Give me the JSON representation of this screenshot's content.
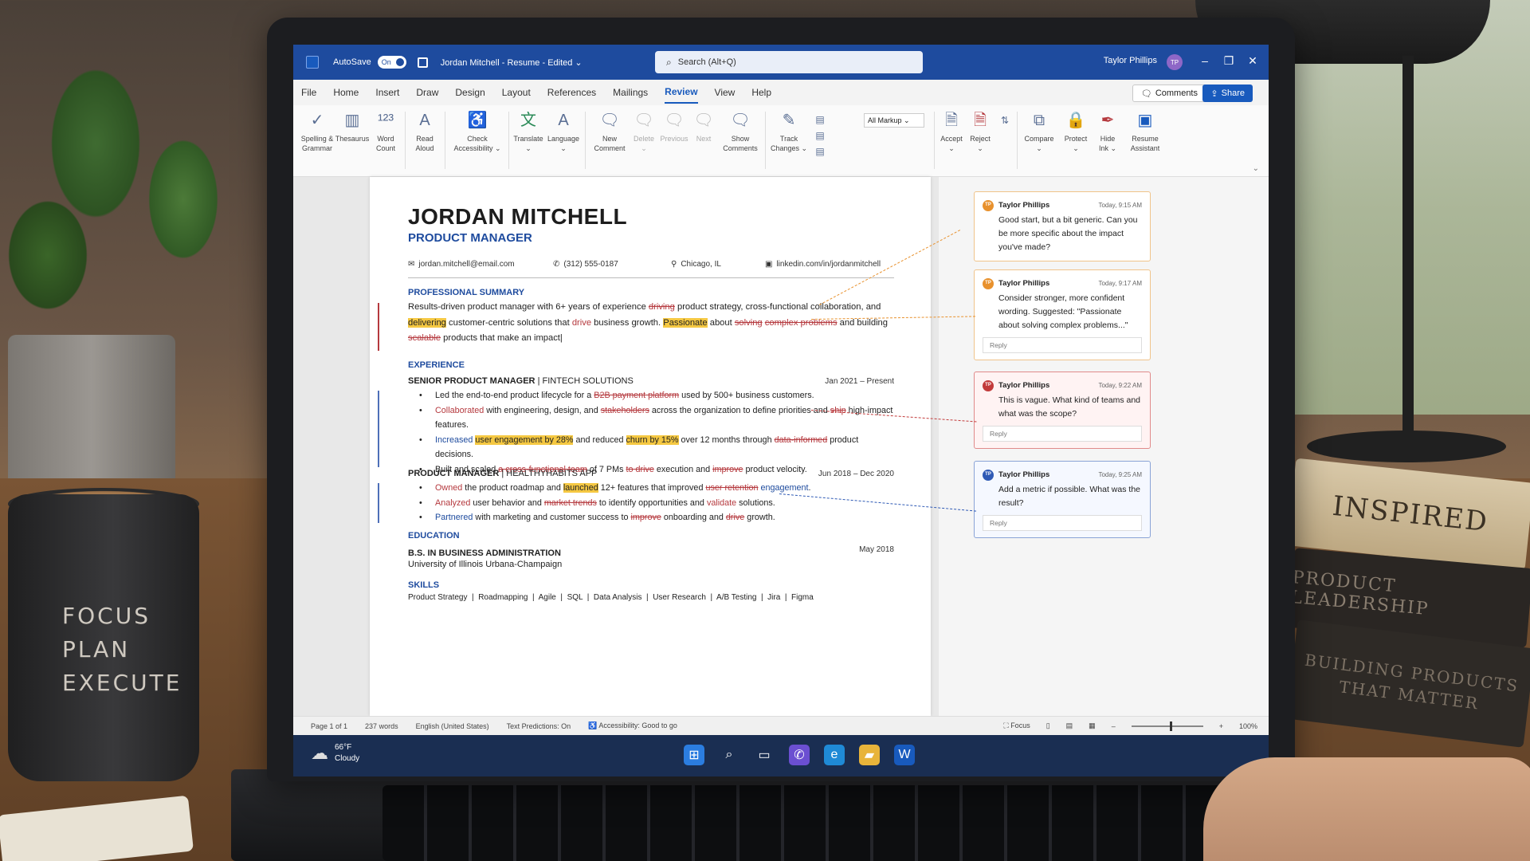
{
  "app": {
    "autosave_label": "AutoSave",
    "autosave_state": "On",
    "doc_title": "Jordan Mitchell - Resume - Edited ⌄",
    "search_placeholder": "Search (Alt+Q)",
    "user_name": "Taylor Phillips",
    "user_initials": "TP",
    "accent": "#1e4b9e"
  },
  "tabs": [
    "File",
    "Home",
    "Insert",
    "Draw",
    "Design",
    "Layout",
    "References",
    "Mailings",
    "Review",
    "View",
    "Help"
  ],
  "active_tab": "Review",
  "header_buttons": {
    "comments": "Comments",
    "share": "Share"
  },
  "ribbon": {
    "spelling": "Spelling &\nGrammar",
    "thesaurus": "Thesaurus",
    "word_count": "Word\nCount",
    "read_aloud": "Read\nAloud",
    "check_accessibility": "Check\nAccessibility ⌄",
    "translate": "Translate\n⌄",
    "language": "Language\n⌄",
    "new_comment": "New\nComment",
    "delete": "Delete\n⌄",
    "previous": "Previous",
    "next": "Next",
    "show_comments": "Show\nComments",
    "track_changes": "Track\nChanges ⌄",
    "markup_select": "All Markup",
    "accept": "Accept\n⌄",
    "reject": "Reject\n⌄",
    "compare": "Compare\n⌄",
    "protect": "Protect\n⌄",
    "hide_ink": "Hide\nInk ⌄",
    "resume_assistant": "Resume\nAssistant"
  },
  "resume": {
    "name": "JORDAN MITCHELL",
    "title": "PRODUCT MANAGER",
    "email": "jordan.mitchell@email.com",
    "phone": "(312) 555-0187",
    "location": "Chicago, IL",
    "linkedin": "linkedin.com/in/jordanmitchell",
    "summary_heading": "PROFESSIONAL SUMMARY",
    "experience_heading": "EXPERIENCE",
    "job1_title": "SENIOR PRODUCT MANAGER",
    "job1_company": "FINTECH SOLUTIONS",
    "job1_dates": "Jan 2021 – Present",
    "job2_title": "PRODUCT MANAGER",
    "job2_company": "HEALTHYHABITS APP",
    "job2_dates": "Jun 2018 – Dec 2020",
    "education_heading": "EDUCATION",
    "degree": "B.S. IN BUSINESS ADMINISTRATION",
    "school": "University of Illinois Urbana-Champaign",
    "grad_date": "May 2018",
    "skills_heading": "SKILLS",
    "skills": "Product Strategy  |  Roadmapping  |  Agile  |  SQL  |  Data Analysis  |  User Research  |  A/B Testing  |  Jira  |  Figma"
  },
  "comments": [
    {
      "author": "Taylor Phillips",
      "time": "Today, 9:15 AM",
      "text": "Good start, but a bit generic. Can you be more specific about the impact you've made?",
      "reply": ""
    },
    {
      "author": "Taylor Phillips",
      "time": "Today, 9:17 AM",
      "text": "Consider stronger, more confident wording. Suggested: \"Passionate about solving complex problems...\"",
      "reply": "Reply"
    },
    {
      "author": "Taylor Phillips",
      "time": "Today, 9:22 AM",
      "text": "This is vague. What kind of teams and what was the scope?",
      "reply": "Reply"
    },
    {
      "author": "Taylor Phillips",
      "time": "Today, 9:25 AM",
      "text": "Add a metric if possible. What was the result?",
      "reply": "Reply"
    }
  ],
  "status": {
    "page": "Page 1 of 1",
    "words": "237 words",
    "language": "English (United States)",
    "predictions": "Text Predictions: On",
    "accessibility": "Accessibility: Good to go",
    "focus": "Focus",
    "zoom": "100%"
  },
  "taskbar": {
    "temp": "66°F",
    "condition": "Cloudy"
  },
  "scene": {
    "mug_text": [
      "FOCUS",
      "PLAN",
      "EXECUTE"
    ],
    "book1": "INSPIRED",
    "book2": "PRODUCT LEADERSHIP",
    "book3": "BUILDING PRODUCTS\nTHAT MATTER"
  }
}
